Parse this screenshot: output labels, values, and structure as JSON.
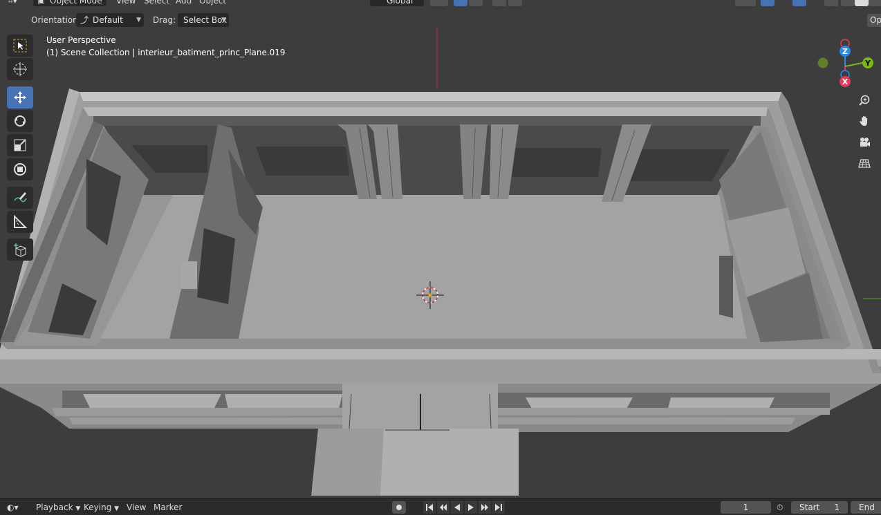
{
  "header": {
    "mode_label": "Object Mode",
    "menus": [
      "View",
      "Select",
      "Add",
      "Object"
    ],
    "transform_orientation": "Global"
  },
  "tool_settings": {
    "orientation_label": "Orientation:",
    "orientation_value": "Default",
    "drag_label": "Drag:",
    "drag_value": "Select Box",
    "options_label": "Op"
  },
  "viewport": {
    "view_name": "User Perspective",
    "collection_info": "(1) Scene Collection | interieur_batiment_princ_Plane.019",
    "background_color": "#3d3d3d"
  },
  "toolbar": {
    "tools": [
      {
        "name": "select-box-tool",
        "active": false
      },
      {
        "name": "cursor-tool",
        "active": false
      },
      {
        "name": "move-tool",
        "active": true
      },
      {
        "name": "rotate-tool",
        "active": false
      },
      {
        "name": "scale-tool",
        "active": false
      },
      {
        "name": "transform-tool",
        "active": false
      },
      {
        "name": "annotate-tool",
        "active": false
      },
      {
        "name": "measure-tool",
        "active": false
      },
      {
        "name": "add-cube-tool",
        "active": false
      }
    ],
    "active_color": "#4772b3"
  },
  "gizmo": {
    "axes": {
      "z": "Z",
      "y": "Y",
      "x": "X"
    },
    "colors": {
      "x": "#e8395a",
      "y": "#7ab817",
      "z": "#2b88ed"
    }
  },
  "navigation": [
    "zoom-icon",
    "pan-hand-icon",
    "camera-icon",
    "ortho-grid-icon"
  ],
  "timeline": {
    "menus": [
      "Playback",
      "Keying",
      "View",
      "Marker"
    ],
    "current_frame": "1",
    "start_label": "Start",
    "start_value": "1",
    "end_label": "End"
  }
}
